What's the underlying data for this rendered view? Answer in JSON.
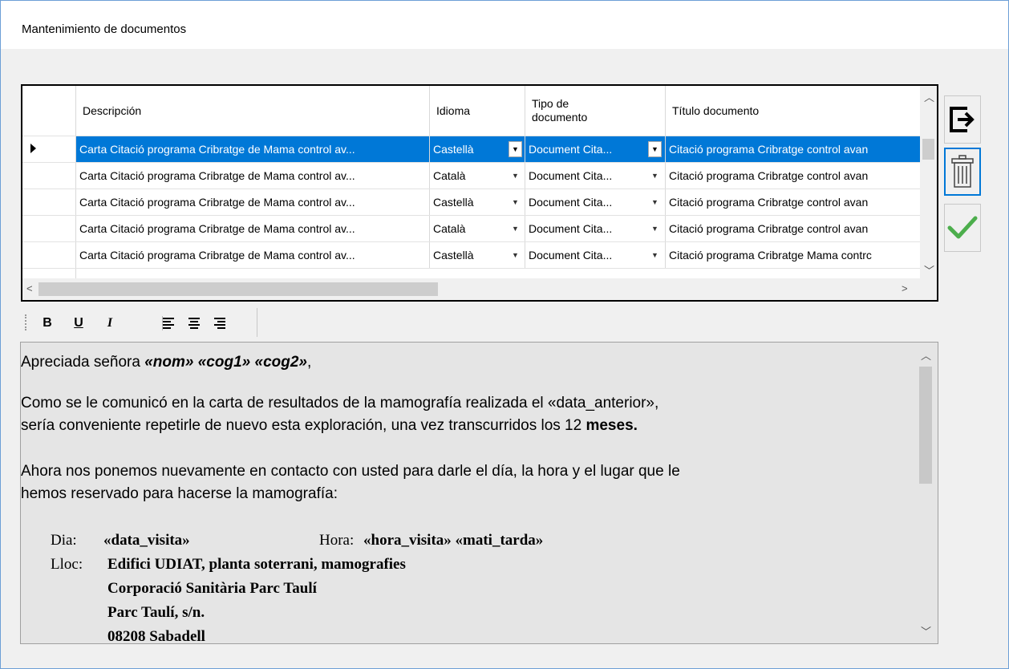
{
  "window": {
    "title": "Mantenimiento de documentos"
  },
  "grid": {
    "columns": [
      {
        "label": "Descripción"
      },
      {
        "label": "Idioma"
      },
      {
        "label_line1": "Tipo de",
        "label_line2": "documento"
      },
      {
        "label": "Título documento"
      }
    ],
    "rows": [
      {
        "descripcion": "Carta Citació programa Cribratge de Mama control av...",
        "idioma": "Castellà",
        "tipo": "Document Cita...",
        "titulo": "Citació programa Cribratge control avan"
      },
      {
        "descripcion": "Carta Citació programa Cribratge de Mama control av...",
        "idioma": "Català",
        "tipo": "Document Cita...",
        "titulo": "Citació programa Cribratge control avan"
      },
      {
        "descripcion": "Carta Citació programa Cribratge de Mama control av...",
        "idioma": "Castellà",
        "tipo": "Document Cita...",
        "titulo": "Citació programa Cribratge control avan"
      },
      {
        "descripcion": "Carta Citació programa Cribratge de Mama control av...",
        "idioma": "Català",
        "tipo": "Document Cita...",
        "titulo": "Citació programa Cribratge control avan"
      },
      {
        "descripcion": "Carta Citació programa Cribratge de Mama control av...",
        "idioma": "Castellà",
        "tipo": "Document Cita...",
        "titulo": "Citació programa Cribratge Mama contrc"
      }
    ],
    "selected_row": 0
  },
  "side_buttons": [
    {
      "name": "exit-icon"
    },
    {
      "name": "trash-icon"
    },
    {
      "name": "check-icon"
    }
  ],
  "toolbar": {
    "bold": "B",
    "underline": "U",
    "italic": "I"
  },
  "editor": {
    "greeting_prefix": "Apreciada señora ",
    "greeting_fields": "«nom» «cog1» «cog2»",
    "greeting_suffix": ",",
    "para1_line1": "Como se le comunicó en la carta de resultados de la mamografía realizada el «data_anterior»,",
    "para1_line2_prefix": "sería conveniente repetirle de nuevo esta exploración, una vez transcurridos los 12 ",
    "para1_line2_bold": "meses.",
    "para2_line1": "Ahora nos ponemos nuevamente en contacto con usted para darle el día, la hora y el lugar que le",
    "para2_line2": "hemos reservado para hacerse la mamografía:",
    "dia_label": "Dia:",
    "dia_value": "«data_visita»",
    "hora_label": "Hora:",
    "hora_value": "«hora_visita»  «mati_tarda»",
    "lloc_label": "Lloc:",
    "lloc_line1": "Edifici UDIAT, planta soterrani, mamografies",
    "lloc_line2": "Corporació Sanitària Parc Taulí",
    "lloc_line3": "Parc Taulí, s/n.",
    "lloc_line4": "08208 Sabadell"
  }
}
